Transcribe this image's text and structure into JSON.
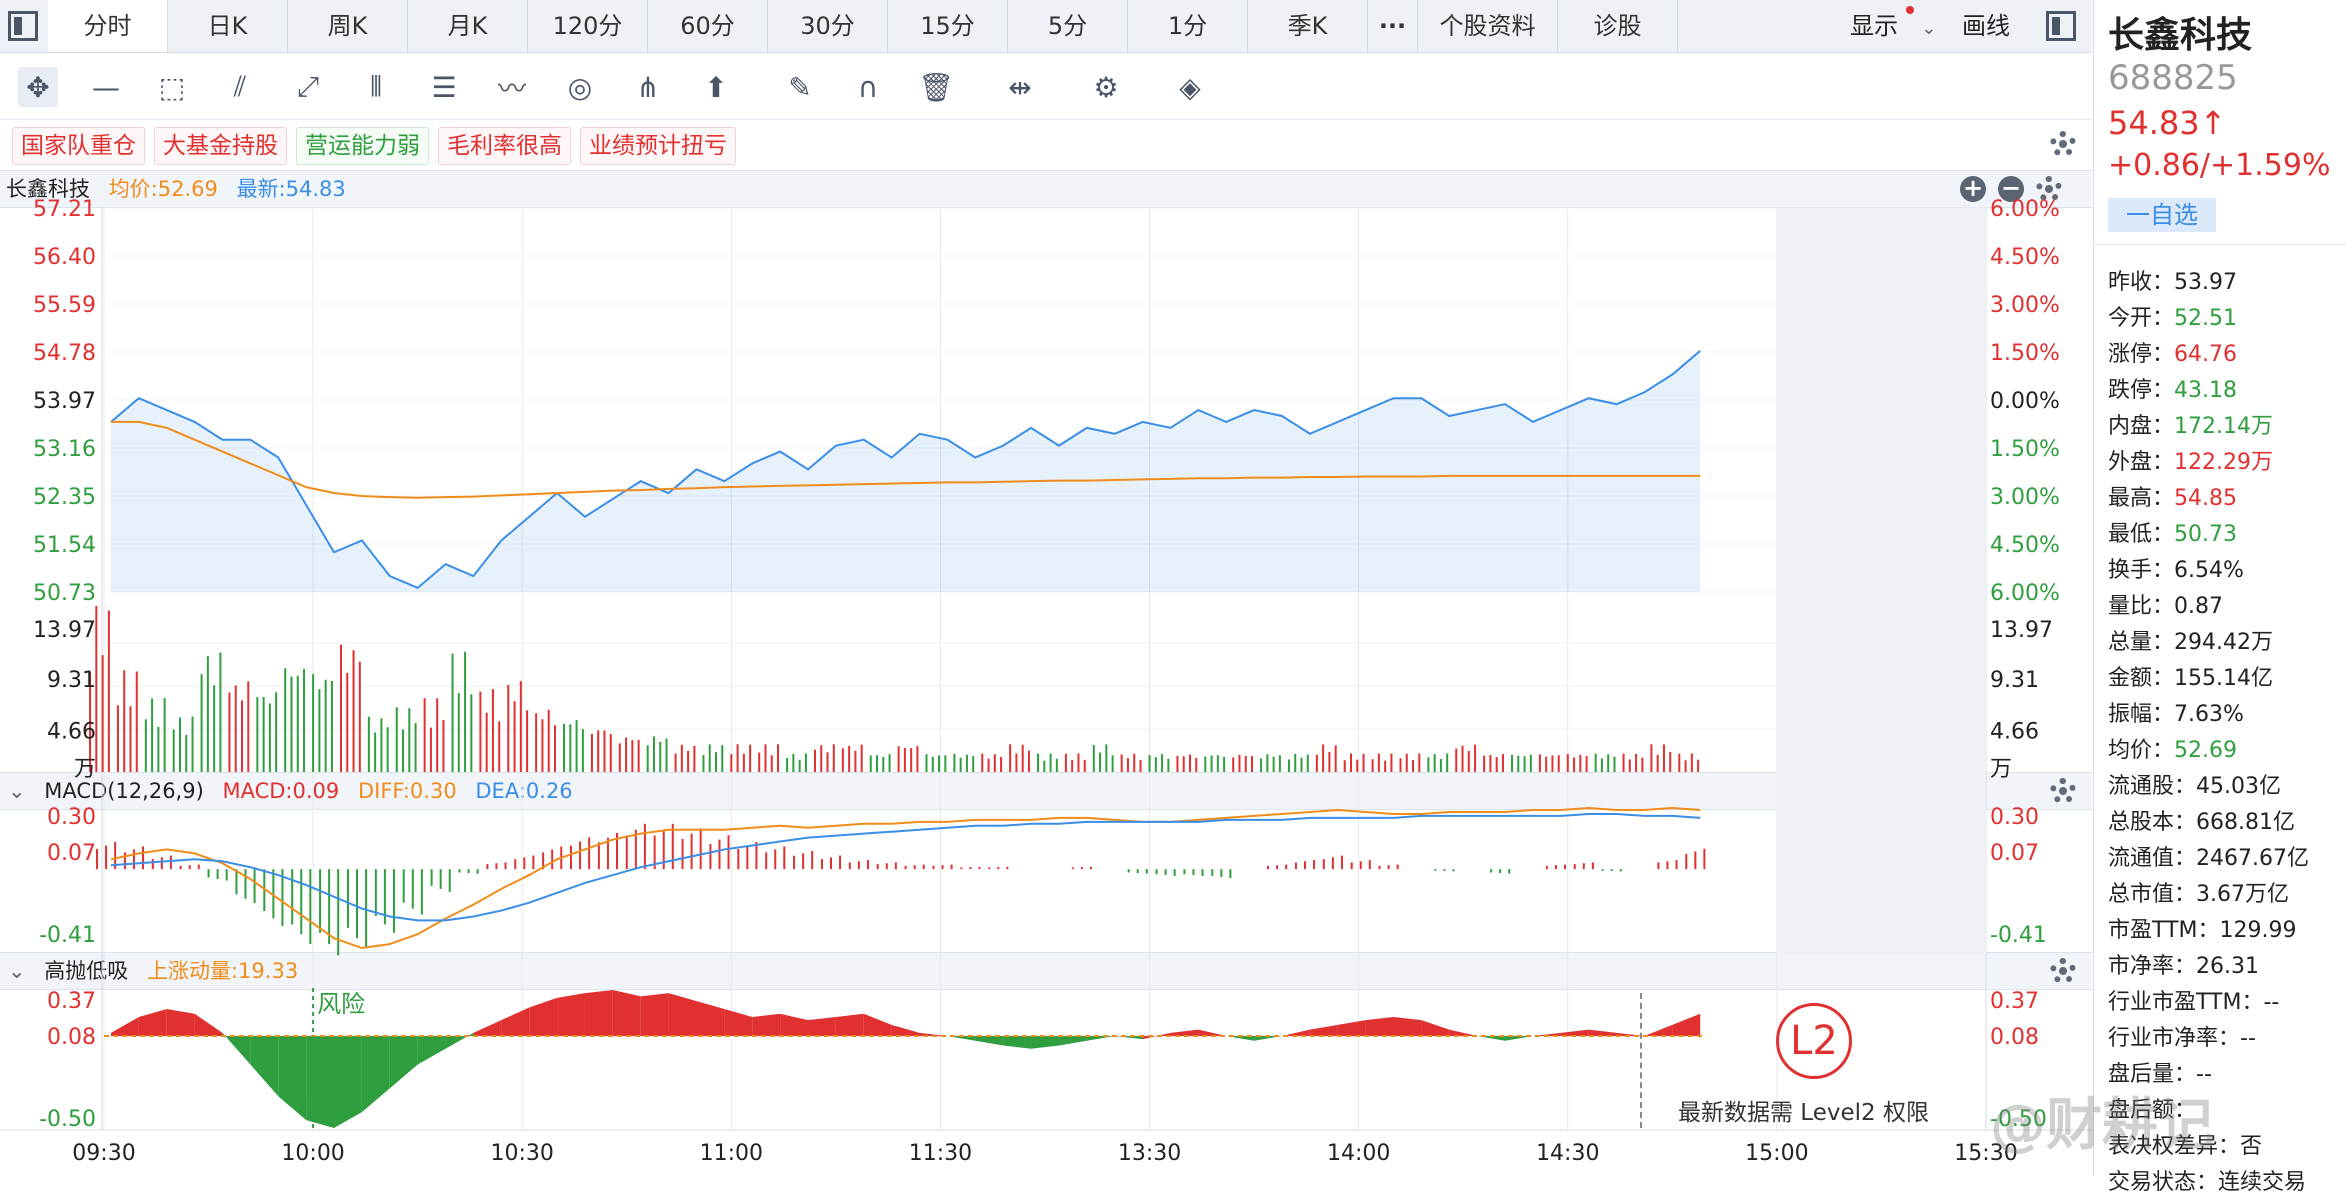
{
  "tabs": [
    "分时",
    "日K",
    "周K",
    "月K",
    "120分",
    "60分",
    "30分",
    "15分",
    "5分",
    "1分",
    "季K",
    "···",
    "个股资料",
    "诊股"
  ],
  "display_label": "显示",
  "draw_label": "画线",
  "tags": [
    {
      "label": "国家队重仓",
      "color": "red"
    },
    {
      "label": "大基金持股",
      "color": "red"
    },
    {
      "label": "营运能力弱",
      "color": "green"
    },
    {
      "label": "毛利率很高",
      "color": "red"
    },
    {
      "label": "业绩预计扭亏",
      "color": "red"
    }
  ],
  "main_header": {
    "name": "长鑫科技",
    "avg": "均价:52.69",
    "latest": "最新:54.83"
  },
  "macd_header": {
    "name": "MACD(12,26,9)",
    "macd": "MACD:0.09",
    "diff": "DIFF:0.30",
    "dea": "DEA:0.26"
  },
  "gpdx_header": {
    "name": "高抛低吸",
    "momentum": "上涨动量:19.33"
  },
  "left_price_ticks": [
    "57.21",
    "56.40",
    "55.59",
    "54.78",
    "53.97",
    "53.16",
    "52.35",
    "51.54",
    "50.73"
  ],
  "right_pct_ticks": [
    "6.00%",
    "4.50%",
    "3.00%",
    "1.50%",
    "0.00%",
    "1.50%",
    "3.00%",
    "4.50%",
    "6.00%"
  ],
  "volume_ticks": [
    "13.97",
    "9.31",
    "4.66",
    "万"
  ],
  "macd_ticks": [
    "0.30",
    "0.07",
    "-0.41"
  ],
  "gpdx_ticks": [
    "0.37",
    "0.08",
    "-0.50"
  ],
  "time_ticks": [
    "09:30",
    "10:00",
    "10:30",
    "11:00",
    "11:30",
    "13:30",
    "14:00",
    "14:30",
    "15:00",
    "15:30"
  ],
  "risk_label": "风险",
  "level2_badge": "L2",
  "level2_text": "最新数据需 Level2 权限",
  "stock": {
    "name": "长鑫科技",
    "code": "688825",
    "price": "54.83↑",
    "change": "+0.86/+1.59%",
    "watch_button": "一自选"
  },
  "stats": [
    {
      "label": "昨收：",
      "value": "53.97",
      "color": "black"
    },
    {
      "label": "今开：",
      "value": "52.51",
      "color": "green"
    },
    {
      "label": "涨停：",
      "value": "64.76",
      "color": "red"
    },
    {
      "label": "跌停：",
      "value": "43.18",
      "color": "green"
    },
    {
      "label": "内盘：",
      "value": "172.14万",
      "color": "green"
    },
    {
      "label": "外盘：",
      "value": "122.29万",
      "color": "red"
    },
    {
      "label": "最高：",
      "value": "54.85",
      "color": "red"
    },
    {
      "label": "最低：",
      "value": "50.73",
      "color": "green"
    },
    {
      "label": "换手：",
      "value": "6.54%",
      "color": "black"
    },
    {
      "label": "量比：",
      "value": "0.87",
      "color": "black"
    },
    {
      "label": "总量：",
      "value": "294.42万",
      "color": "black"
    },
    {
      "label": "金额：",
      "value": "155.14亿",
      "color": "black"
    },
    {
      "label": "振幅：",
      "value": "7.63%",
      "color": "black"
    },
    {
      "label": "均价：",
      "value": "52.69",
      "color": "green"
    },
    {
      "label": "流通股：",
      "value": "45.03亿",
      "color": "black"
    },
    {
      "label": "总股本：",
      "value": "668.81亿",
      "color": "black"
    },
    {
      "label": "流通值：",
      "value": "2467.67亿",
      "color": "black"
    },
    {
      "label": "总市值：",
      "value": "3.67万亿",
      "color": "black"
    },
    {
      "label": "市盈TTM：",
      "value": "129.99",
      "color": "black"
    },
    {
      "label": "市净率：",
      "value": "26.31",
      "color": "black"
    },
    {
      "label": "行业市盈TTM：",
      "value": "--",
      "color": "black"
    },
    {
      "label": "行业市净率：",
      "value": "--",
      "color": "black"
    },
    {
      "label": "盘后量：",
      "value": "--",
      "color": "black"
    },
    {
      "label": "盘后额：",
      "value": "",
      "color": "black"
    },
    {
      "label": "表决权差异：",
      "value": "否",
      "color": "black"
    },
    {
      "label": "交易状态：",
      "value": "连续交易",
      "color": "black"
    }
  ],
  "watermark": "@财耕记",
  "colors": {
    "up": "#e03030",
    "down": "#2e9e3e",
    "price_line": "#3a8ee6",
    "avg_line": "#f08c1a"
  },
  "chart_data": {
    "type": "line",
    "price": [
      53.6,
      54.0,
      53.8,
      53.6,
      53.3,
      53.3,
      53.0,
      52.2,
      51.4,
      51.6,
      51.0,
      50.8,
      51.2,
      51.0,
      51.6,
      52.0,
      52.4,
      52.0,
      52.3,
      52.6,
      52.4,
      52.8,
      52.6,
      52.9,
      53.1,
      52.8,
      53.2,
      53.3,
      53.0,
      53.4,
      53.3,
      53.0,
      53.2,
      53.5,
      53.2,
      53.5,
      53.4,
      53.6,
      53.5,
      53.8,
      53.6,
      53.8,
      53.7,
      53.4,
      53.6,
      53.8,
      54.0,
      54.0,
      53.7,
      53.8,
      53.9,
      53.6,
      53.8,
      54.0,
      53.9,
      54.1,
      54.4,
      54.8
    ],
    "avg": [
      53.6,
      53.6,
      53.5,
      53.3,
      53.1,
      52.9,
      52.7,
      52.5,
      52.4,
      52.35,
      52.33,
      52.32,
      52.33,
      52.34,
      52.36,
      52.38,
      52.4,
      52.42,
      52.44,
      52.45,
      52.47,
      52.48,
      52.5,
      52.51,
      52.52,
      52.53,
      52.54,
      52.55,
      52.56,
      52.57,
      52.58,
      52.58,
      52.59,
      52.6,
      52.61,
      52.61,
      52.62,
      52.63,
      52.64,
      52.65,
      52.65,
      52.66,
      52.66,
      52.67,
      52.67,
      52.68,
      52.68,
      52.68,
      52.69,
      52.69,
      52.69,
      52.69,
      52.69,
      52.69,
      52.69,
      52.69,
      52.69,
      52.69
    ],
    "volume": [
      18,
      11,
      8,
      6,
      13,
      10,
      9,
      12,
      11,
      14,
      6,
      7,
      8,
      13,
      9,
      10,
      7,
      6,
      5,
      4,
      4,
      3,
      3,
      3,
      3,
      2,
      3,
      3,
      2,
      3,
      2,
      2,
      2,
      3,
      2,
      2,
      3,
      2,
      2,
      2,
      2,
      2,
      2,
      2,
      3,
      2,
      2,
      2,
      2,
      3,
      2,
      2,
      2,
      2,
      2,
      2,
      3,
      2
    ],
    "macd": [
      0.12,
      0.1,
      0.06,
      0.02,
      -0.05,
      -0.15,
      -0.25,
      -0.33,
      -0.38,
      -0.35,
      -0.28,
      -0.2,
      -0.1,
      -0.02,
      0.03,
      0.06,
      0.1,
      0.14,
      0.16,
      0.2,
      0.2,
      0.18,
      0.15,
      0.12,
      0.1,
      0.08,
      0.06,
      0.04,
      0.03,
      0.02,
      0.02,
      0.01,
      0.01,
      0.0,
      0.0,
      0.01,
      0.0,
      -0.02,
      -0.03,
      -0.03,
      -0.04,
      0.0,
      0.02,
      0.04,
      0.06,
      0.04,
      0.02,
      0.0,
      -0.01,
      0.0,
      -0.02,
      0.0,
      0.02,
      0.03,
      -0.01,
      0.0,
      0.04,
      0.09
    ],
    "diff": [
      0.05,
      0.08,
      0.1,
      0.08,
      0.03,
      -0.05,
      -0.15,
      -0.25,
      -0.35,
      -0.4,
      -0.38,
      -0.33,
      -0.25,
      -0.18,
      -0.1,
      -0.03,
      0.05,
      0.1,
      0.15,
      0.18,
      0.2,
      0.2,
      0.2,
      0.21,
      0.22,
      0.21,
      0.22,
      0.23,
      0.23,
      0.24,
      0.24,
      0.25,
      0.25,
      0.25,
      0.26,
      0.26,
      0.25,
      0.24,
      0.24,
      0.25,
      0.26,
      0.27,
      0.28,
      0.29,
      0.3,
      0.29,
      0.28,
      0.28,
      0.29,
      0.29,
      0.29,
      0.3,
      0.3,
      0.31,
      0.3,
      0.3,
      0.31,
      0.3
    ],
    "dea": [
      0.02,
      0.03,
      0.04,
      0.05,
      0.04,
      0.01,
      -0.03,
      -0.08,
      -0.14,
      -0.2,
      -0.24,
      -0.26,
      -0.26,
      -0.24,
      -0.21,
      -0.17,
      -0.12,
      -0.07,
      -0.03,
      0.01,
      0.04,
      0.07,
      0.1,
      0.12,
      0.14,
      0.16,
      0.17,
      0.18,
      0.19,
      0.2,
      0.21,
      0.22,
      0.22,
      0.23,
      0.23,
      0.24,
      0.24,
      0.24,
      0.24,
      0.24,
      0.25,
      0.25,
      0.25,
      0.26,
      0.26,
      0.26,
      0.26,
      0.27,
      0.27,
      0.27,
      0.27,
      0.27,
      0.27,
      0.28,
      0.28,
      0.27,
      0.27,
      0.26
    ],
    "gpdx": [
      0.1,
      0.2,
      0.25,
      0.22,
      0.1,
      -0.1,
      -0.3,
      -0.45,
      -0.5,
      -0.4,
      -0.25,
      -0.1,
      0.0,
      0.1,
      0.18,
      0.26,
      0.32,
      0.35,
      0.37,
      0.33,
      0.35,
      0.3,
      0.25,
      0.2,
      0.22,
      0.18,
      0.2,
      0.22,
      0.15,
      0.1,
      0.08,
      0.05,
      0.02,
      0.0,
      0.02,
      0.05,
      0.08,
      0.06,
      0.1,
      0.12,
      0.08,
      0.05,
      0.08,
      0.12,
      0.15,
      0.18,
      0.2,
      0.18,
      0.12,
      0.08,
      0.05,
      0.08,
      0.1,
      0.12,
      0.1,
      0.08,
      0.15,
      0.22
    ],
    "price_range": [
      50.73,
      57.21
    ],
    "prev_close": 53.97,
    "volume_range": [
      0,
      18.6
    ],
    "macd_range": [
      -0.41,
      0.3
    ],
    "gpdx_range": [
      -0.5,
      0.37
    ],
    "gpdx_baseline": 0.08
  }
}
